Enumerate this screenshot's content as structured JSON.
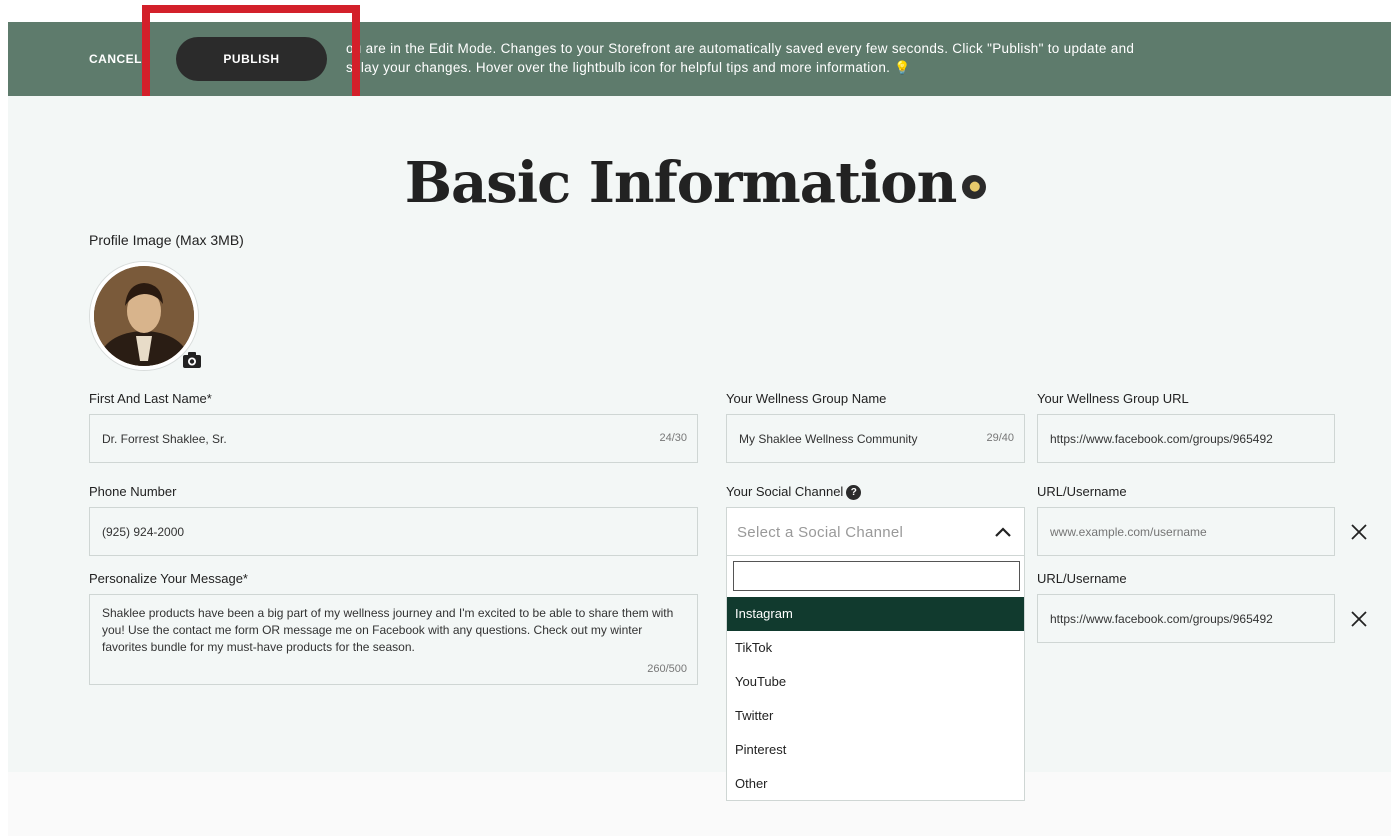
{
  "edit_bar": {
    "cancel_label": "CANCEL",
    "publish_label": "PUBLISH",
    "message_line1": "ou are in the Edit Mode. Changes to your Storefront are automatically saved every few seconds. Click \"Publish\" to update and",
    "message_line2": "splay your changes. Hover over the lightbulb icon for helpful tips and more information."
  },
  "page": {
    "title": "Basic Information"
  },
  "profile": {
    "image_label": "Profile Image (Max 3MB)"
  },
  "form": {
    "name": {
      "label": "First And Last Name*",
      "value": "Dr. Forrest Shaklee, Sr.",
      "counter": "24/30"
    },
    "phone": {
      "label": "Phone Number",
      "value": "(925) 924-2000"
    },
    "message": {
      "label": "Personalize Your Message*",
      "value": "Shaklee products have been a big part of my wellness journey and I'm excited to be able to share them with you! Use the contact me form OR message me on Facebook with any questions. Check out my winter favorites bundle for my must-have products for the season.",
      "counter": "260/500"
    },
    "group_name": {
      "label": "Your Wellness Group Name",
      "value": "My Shaklee Wellness Community",
      "counter": "29/40"
    },
    "group_url": {
      "label": "Your Wellness Group URL",
      "value": "https://www.facebook.com/groups/965492"
    },
    "social_channel": {
      "label": "Your Social Channel",
      "placeholder": "Select a Social Channel",
      "search_value": "",
      "options": [
        "Instagram",
        "TikTok",
        "YouTube",
        "Twitter",
        "Pinterest",
        "Other"
      ],
      "highlighted": "Instagram"
    },
    "url_username_1": {
      "label": "URL/Username",
      "placeholder": "www.example.com/username",
      "value": ""
    },
    "url_username_2": {
      "label": "URL/Username",
      "value": "https://www.facebook.com/groups/965492"
    }
  },
  "colors": {
    "edit_bar_bg": "#5e7b6c",
    "publish_bg": "#2b2b2b",
    "highlight_box": "#d3202a",
    "dropdown_active": "#113a2e",
    "main_bg": "#f3f7f6"
  },
  "icons": {
    "lightbulb": "lightbulb-icon",
    "camera": "camera-icon",
    "help": "question-circle-icon",
    "chevron": "chevron-up-icon",
    "close": "close-icon"
  }
}
